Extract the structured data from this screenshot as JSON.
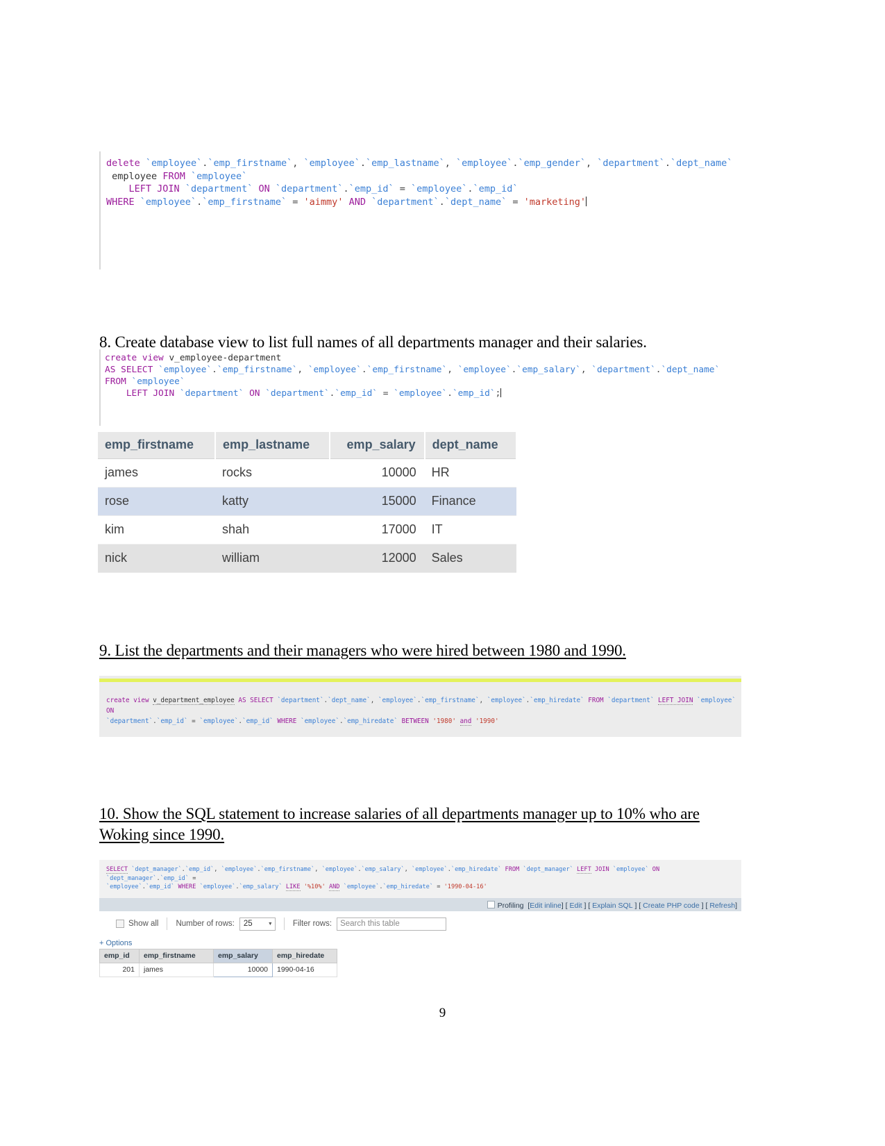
{
  "document": {
    "page_number": "9"
  },
  "block_delete": {
    "name": "delete-statement",
    "lines": [
      "delete `employee`.`emp_firstname`, `employee`.`emp_lastname`, `employee`.`emp_gender`, `department`.`dept_name`",
      " employee FROM `employee`",
      "    LEFT JOIN `department` ON `department`.`emp_id` = `employee`.`emp_id`",
      "WHERE `employee`.`emp_firstname` = 'aimmy' AND `department`.`dept_name` = 'marketing'"
    ]
  },
  "q8": {
    "heading": "8. Create database view to list full names of all departments manager and their salaries.",
    "code_lines": [
      "create view v_employee-department",
      "AS SELECT `employee`.`emp_firstname`, `employee`.`emp_firstname`, `employee`.`emp_salary`, `department`.`dept_name`",
      "FROM `employee`",
      "    LEFT JOIN `department` ON `department`.`emp_id` = `employee`.`emp_id`;"
    ],
    "table": {
      "columns": [
        "emp_firstname",
        "emp_lastname",
        "emp_salary",
        "dept_name"
      ],
      "rows": [
        [
          "james",
          "rocks",
          "10000",
          "HR"
        ],
        [
          "rose",
          "katty",
          "15000",
          "Finance"
        ],
        [
          "kim",
          "shah",
          "17000",
          "IT"
        ],
        [
          "nick",
          "william",
          "12000",
          "Sales"
        ]
      ]
    }
  },
  "q9": {
    "heading": "9. List the departments and their managers who were hired between 1980 and 1990.",
    "code": "create view v_department_employee AS SELECT `department`.`dept_name`, `employee`.`emp_firstname`, `employee`.`emp_hiredate` FROM `department` LEFT JOIN `employee` ON `department`.`emp_id` = `employee`.`emp_id` WHERE `employee`.`emp_hiredate` BETWEEN '1980' and '1990'"
  },
  "q10": {
    "heading": "10. Show the SQL statement to increase salaries of all departments manager up to 10% who are Woking since 1990.",
    "sql": "SELECT `dept_manager`.`emp_id`, `employee`.`emp_firstname`, `employee`.`emp_salary`, `employee`.`emp_hiredate` FROM `dept_manager` LEFT JOIN `employee` ON `dept_manager`.`emp_id` = `employee`.`emp_id` WHERE `employee`.`emp_salary` LIKE '%10%' AND `employee`.`emp_hiredate` = '1990-04-16'",
    "actionbar": {
      "profiling_label": "Profiling",
      "links": [
        "Edit inline",
        "Edit",
        "Explain SQL",
        "Create PHP code",
        "Refresh"
      ]
    },
    "toolbar": {
      "show_all_label": "Show all",
      "number_of_rows_label": "Number of rows:",
      "number_of_rows_value": "25",
      "filter_rows_label": "Filter rows:",
      "filter_placeholder": "Search this table"
    },
    "options_link": "+ Options",
    "result_table": {
      "columns": [
        "emp_id",
        "emp_firstname",
        "emp_salary",
        "emp_hiredate"
      ],
      "rows": [
        [
          "201",
          "james",
          "10000",
          "1990-04-16"
        ]
      ]
    }
  },
  "colors": {
    "keyword": "#9b1b9b",
    "identifier": "#3a7fd5",
    "string": "#c0392b",
    "table_header_bg": "#e8e8e8",
    "highlight_row": "#d2dced",
    "actionbar_bg": "#d6dde4",
    "q9_accent": "#e4f25c"
  }
}
